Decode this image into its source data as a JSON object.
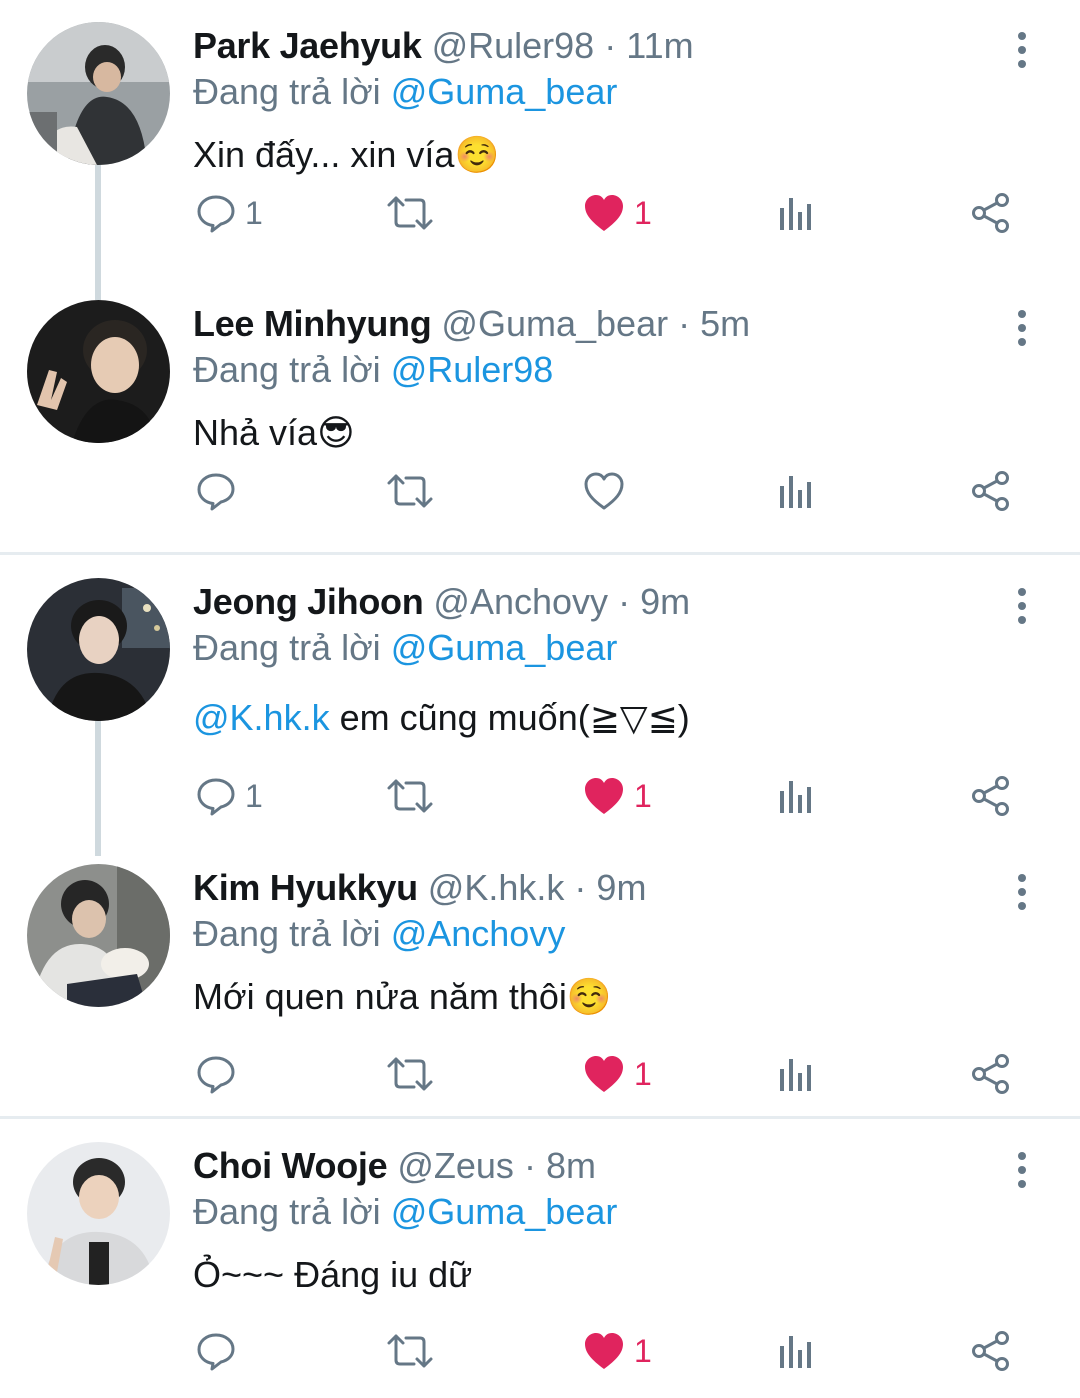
{
  "tweets": [
    {
      "name": "Park Jaehyuk",
      "handle": "@Ruler98",
      "time": "11m",
      "reply_prefix": "Đang trả lời",
      "reply_to": "@Guma_bear",
      "text": "Xin đấy... xin vía☺️",
      "text_mention": "",
      "replies": "1",
      "liked": true,
      "likes": "1"
    },
    {
      "name": "Lee Minhyung",
      "handle": "@Guma_bear",
      "time": "5m",
      "reply_prefix": "Đang trả lời",
      "reply_to": "@Ruler98",
      "text": "Nhả vía😎",
      "text_mention": "",
      "replies": "",
      "liked": false,
      "likes": ""
    },
    {
      "name": "Jeong Jihoon",
      "handle": "@Anchovy",
      "time": "9m",
      "reply_prefix": "Đang trả lời",
      "reply_to": "@Guma_bear",
      "text": " em cũng muốn(≧▽≦)",
      "text_mention": "@K.hk.k",
      "replies": "1",
      "liked": true,
      "likes": "1"
    },
    {
      "name": "Kim Hyukkyu",
      "handle": "@K.hk.k",
      "time": "9m",
      "reply_prefix": "Đang trả lời",
      "reply_to": "@Anchovy",
      "text": "Mới quen nửa năm thôi☺️",
      "text_mention": "",
      "replies": "",
      "liked": true,
      "likes": "1"
    },
    {
      "name": "Choi Wooje",
      "handle": "@Zeus",
      "time": "8m",
      "reply_prefix": "Đang trả lời",
      "reply_to": "@Guma_bear",
      "text": "Ỏ~~~ Đáng iu dữ",
      "text_mention": "",
      "replies": "",
      "liked": true,
      "likes": "1"
    }
  ],
  "separator": "·",
  "colors": {
    "like": "#e0245e",
    "mention": "#1b95e0",
    "muted": "#657786",
    "thread_line": "#cfd9de"
  }
}
